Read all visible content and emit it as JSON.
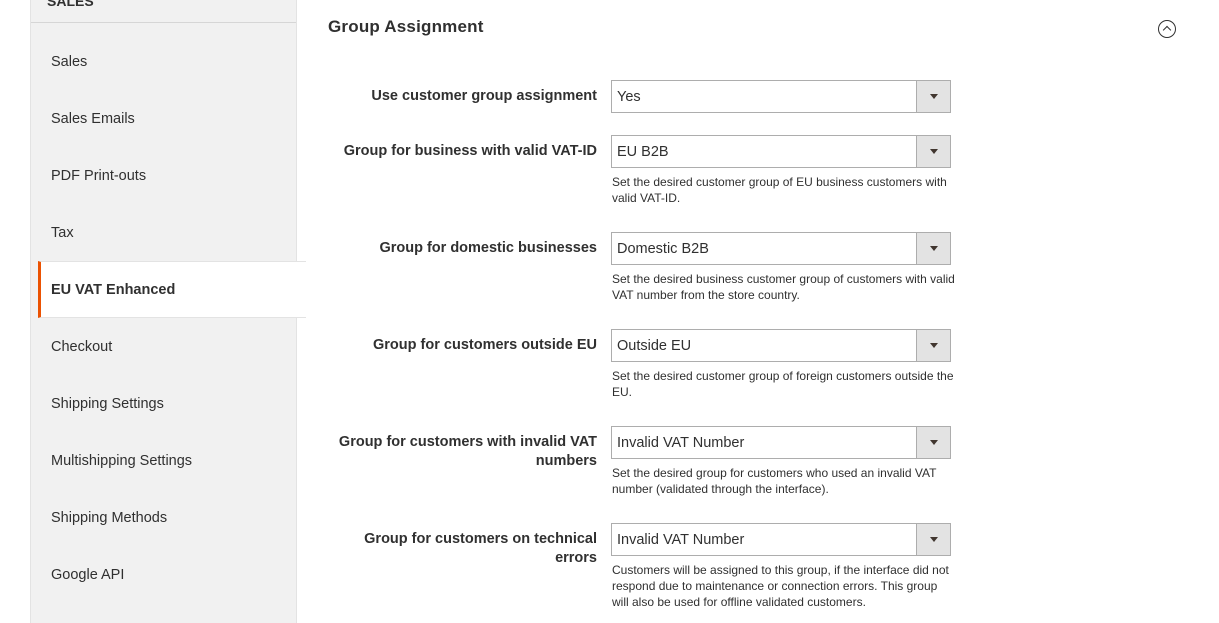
{
  "sidebar": {
    "section_title": "Sales",
    "items": [
      {
        "label": "Sales"
      },
      {
        "label": "Sales Emails"
      },
      {
        "label": "PDF Print-outs"
      },
      {
        "label": "Tax"
      },
      {
        "label": "EU VAT Enhanced",
        "active": true
      },
      {
        "label": "Checkout"
      },
      {
        "label": "Shipping Settings"
      },
      {
        "label": "Multishipping Settings"
      },
      {
        "label": "Shipping Methods"
      },
      {
        "label": "Google API"
      }
    ]
  },
  "section": {
    "title": "Group Assignment",
    "collapse_icon": "chevron-up-circle-icon"
  },
  "fields": [
    {
      "label": "Use customer group assignment",
      "value": "Yes",
      "note": ""
    },
    {
      "label": "Group for business with valid VAT-ID",
      "value": "EU B2B",
      "note": "Set the desired customer group of EU business customers with valid VAT-ID."
    },
    {
      "label": "Group for domestic businesses",
      "value": "Domestic B2B",
      "note": "Set the desired business customer group of customers with valid VAT number from the store country."
    },
    {
      "label": "Group for customers outside EU",
      "value": "Outside EU",
      "note": "Set the desired customer group of foreign customers outside the EU."
    },
    {
      "label": "Group for customers with invalid VAT numbers",
      "value": "Invalid VAT Number",
      "note": "Set the desired group for customers who used an invalid VAT number (validated through the interface)."
    },
    {
      "label": "Group for customers on technical errors",
      "value": "Invalid VAT Number",
      "note": "Customers will be assigned to this group, if the interface did not respond due to maintenance or connection errors. This group will also be used for offline validated customers."
    }
  ],
  "colors": {
    "accent": "#eb5202",
    "sidebar_bg": "#f1f1f1",
    "select_border": "#adadad"
  }
}
